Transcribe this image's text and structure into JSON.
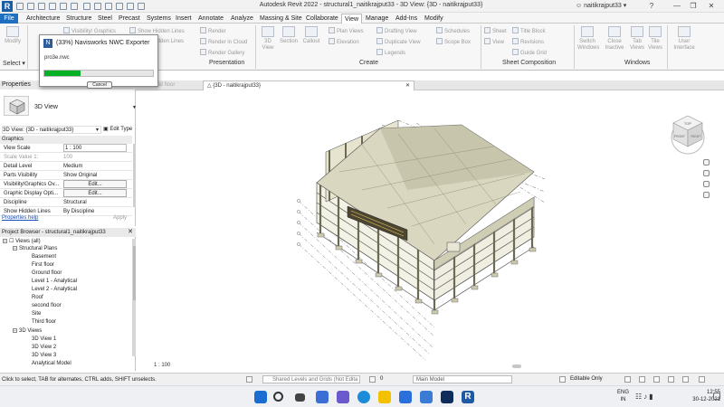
{
  "window": {
    "title": "Autodesk Revit 2022 - structural1_naitikrajput33 - 3D View: {3D - naitikrajput33}",
    "user": "naitikrajput33",
    "logo": "R"
  },
  "ribbon_tabs": [
    "File",
    "Architecture",
    "Structure",
    "Steel",
    "Precast",
    "Systems",
    "Insert",
    "Annotate",
    "Analyze",
    "Massing & Site",
    "Collaborate",
    "View",
    "Manage",
    "Add-Ins",
    "Modify"
  ],
  "active_tab": "View",
  "ribbon": {
    "select_label": "Select",
    "modify_label": "Modify",
    "visibility_graphics": "Visibility/ Graphics",
    "show_hidden_lines": "Show Hidden Lines",
    "hidden_lines": "Hidden Lines",
    "render": "Render",
    "render_in_cloud": "Render in Cloud",
    "render_gallery": "Render Gallery",
    "presentation_label": "Presentation",
    "three_d_view": "3D View",
    "section": "Section",
    "callout": "Callout",
    "plan_views": "Plan Views",
    "elevation": "Elevation",
    "drafting_view": "Drafting View",
    "duplicate_view": "Duplicate View",
    "legends": "Legends",
    "schedules": "Schedules",
    "scope_box": "Scope Box",
    "create_label": "Create",
    "sheet": "Sheet",
    "view": "View",
    "title_block": "Title Block",
    "revisions": "Revisions",
    "guide_grid": "Guide Grid",
    "sheet_composition_label": "Sheet Composition",
    "switch_windows": "Switch Windows",
    "close_inactive": "Close Inactive",
    "tab_views": "Tab Views",
    "tile_views": "Tile Views",
    "windows_label": "Windows",
    "user_interface": "User Interface"
  },
  "progress_dialog": {
    "title": "(33%) Navisworks NWC Exporter",
    "file": "pro3e.nwc",
    "progress": 0.33,
    "cancel_label": "Cancel"
  },
  "properties": {
    "header": "Properties",
    "type_name": "3D View",
    "view_selector": "3D View: {3D - naitikrajput33}",
    "edit_type": "Edit Type",
    "group": "Graphics",
    "rows": [
      {
        "key": "View Scale",
        "value": "1 : 100"
      },
      {
        "key": "Scale Value    1:",
        "value": "100"
      },
      {
        "key": "Detail Level",
        "value": "Medium"
      },
      {
        "key": "Parts Visibility",
        "value": "Show Original"
      },
      {
        "key": "Visibility/Graphics Ov...",
        "value": "Edit..."
      },
      {
        "key": "Graphic Display Opti...",
        "value": "Edit..."
      },
      {
        "key": "Discipline",
        "value": "Structural"
      },
      {
        "key": "Show Hidden Lines",
        "value": "By Discipline"
      }
    ],
    "help_link": "Properties help",
    "apply": "Apply"
  },
  "browser": {
    "header": "Project Browser - structural1_naitikrajput33",
    "root": "Views (all)",
    "structural_plans": "Structural Plans",
    "plans": [
      "Basement",
      "First floor",
      "Ground floor",
      "Level 1 - Analytical",
      "Level 2 - Analytical",
      "Roof",
      "second floor",
      "Site",
      "Third floor"
    ],
    "three_d_views": "3D Views",
    "views3d": [
      "3D View 1",
      "3D View 2",
      "3D View 3",
      "Analytical Model"
    ]
  },
  "view_tabs": {
    "ground": "Ground floor",
    "active": "{3D - naitikrajput33}"
  },
  "viewcube": {
    "top": "TOP",
    "front": "FRONT",
    "right": "RIGHT"
  },
  "view_control": {
    "scale": "1 : 100"
  },
  "status": {
    "text": "Click to select, TAB for alternates, CTRL adds, SHIFT unselects.",
    "workset": "Shared Levels and Grids (Not Edita",
    "workset_count": "0",
    "design_option": "Main Model",
    "editable_only": "Editable Only"
  },
  "taskbar": {
    "lang_top": "ENG",
    "lang_bottom": "IN",
    "time": "12:55",
    "date": "30-12-2021"
  },
  "colors": {
    "accent": "#1f6fc1",
    "progress": "#06b025",
    "slab": "#d9d7bf",
    "slab_shadow": "#b8b69d",
    "column": "#c8c4a6"
  }
}
